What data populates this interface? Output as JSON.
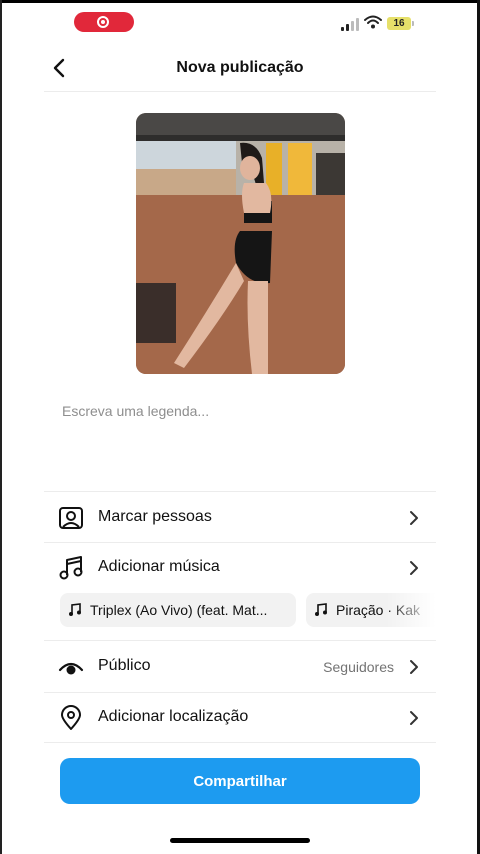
{
  "status_bar": {
    "battery": "16",
    "colors": {
      "recording": "#e1283a",
      "battery": "#e6e06a"
    },
    "icons": [
      "record-icon",
      "signal-icon",
      "wifi-icon",
      "battery-icon"
    ]
  },
  "header": {
    "title": "Nova publicação",
    "back_icon": "chevron-left-icon"
  },
  "caption": {
    "placeholder": "Escreva uma legenda..."
  },
  "options": [
    {
      "label": "Marcar pessoas",
      "icon": "tag-people-icon"
    },
    {
      "label": "Adicionar música",
      "icon": "music-icon"
    },
    {
      "label": "Público",
      "value": "Seguidores",
      "icon": "eye-icon"
    },
    {
      "label": "Adicionar localização",
      "icon": "location-pin-icon"
    }
  ],
  "music_suggestions": [
    {
      "title": "Triplex (Ao Vivo) (feat. Mat..."
    },
    {
      "title": "Piração · Kak"
    }
  ],
  "share": {
    "label": "Compartilhar",
    "color": "#1d9bf0"
  }
}
